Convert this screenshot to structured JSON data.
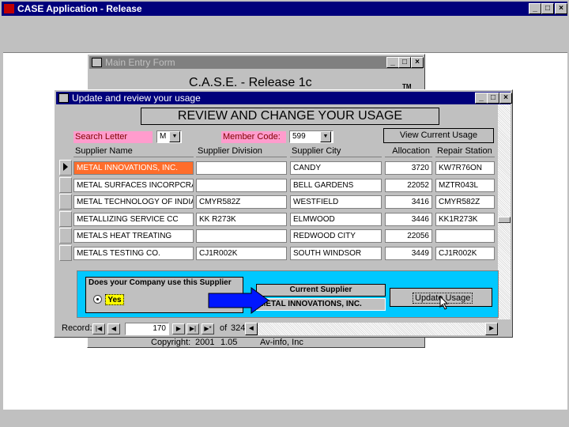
{
  "app": {
    "title": "CASE Application - Release",
    "min": "_",
    "max": "□",
    "close": "×"
  },
  "main_form": {
    "title": "Main Entry Form",
    "heading": "C.A.S.E. - Release 1c",
    "tm": "TM",
    "copyright": "Copyright:",
    "year": "2001",
    "version": "1.05",
    "company": "Av-info, Inc"
  },
  "usage_form": {
    "title": "Update and review your usage",
    "heading": "REVIEW AND CHANGE YOUR USAGE",
    "search_letter_label": "Search Letter",
    "search_letter_value": "M",
    "member_code_label": "Member Code:",
    "member_code_value": "599",
    "view_current_usage": "View Current Usage",
    "columns": [
      "Supplier Name",
      "Supplier Division",
      "Supplier City",
      "Allocation",
      "Repair Station"
    ],
    "rows": [
      {
        "name": "METAL INNOVATIONS, INC.",
        "division": "",
        "city": "CANDY",
        "allocation": "3720",
        "station": "KW7R76ON"
      },
      {
        "name": "METAL SURFACES INCORPCRATE",
        "division": "",
        "city": "BELL GARDENS",
        "allocation": "22052",
        "station": "MZTR043L"
      },
      {
        "name": "METAL TECHNOLOGY OF INDIANA",
        "division": "CMYR582Z",
        "city": "WESTFIELD",
        "allocation": "3416",
        "station": "CMYR582Z"
      },
      {
        "name": "METALLIZING SERVICE CC",
        "division": "KK R273K",
        "city": "ELMWOOD",
        "allocation": "3446",
        "station": "KK1R273K"
      },
      {
        "name": "METALS HEAT TREATING",
        "division": "",
        "city": "REDWOOD CITY",
        "allocation": "22056",
        "station": ""
      },
      {
        "name": "METALS TESTING CO.",
        "division": "CJ1R002K",
        "city": "SOUTH WINDSOR",
        "allocation": "3449",
        "station": "CJ1R002K"
      }
    ],
    "question": "Does your Company use this Supplier",
    "yes_label": "Yes",
    "current_supplier_label": "Current Supplier",
    "current_supplier_value": "METAL INNOVATIONS, INC.",
    "update_usage": "Update Usage",
    "record_label": "Record:",
    "record_current": "170",
    "record_of": "of",
    "record_total": "324"
  },
  "colors": {
    "selected_row": "#ff6d2b",
    "search_label_bg": "#ff9ccd",
    "panel_bg": "#00c8ff",
    "arrow_fill": "#0016ff",
    "title_active": "#00007b"
  }
}
